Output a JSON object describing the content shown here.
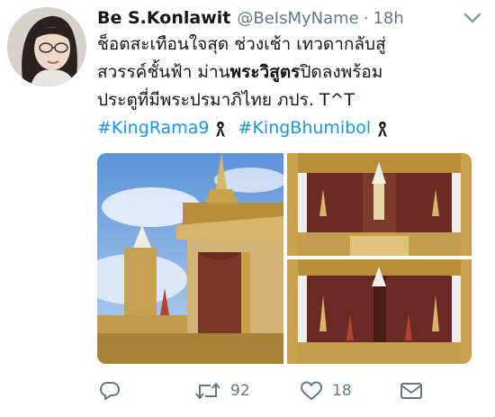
{
  "tweet": {
    "display_name": "Be S.Konlawit",
    "handle": "@BeIsMyName",
    "separator": "·",
    "time": "18h",
    "text": {
      "line1": "ช็อตสะเทือนใจสุด ช่วงเช้า เทวดากลับสู่",
      "line2_a": "สวรรค์ชั้นฟ้า ม่าน",
      "line2_bold": "พระวิสูตร",
      "line2_b": "ปิดลงพร้อม",
      "line3": "ประตูที่มีพระปรมาภิไทย ภปร. T^T"
    },
    "hashtags": [
      "#KingRama9",
      "#KingBhumibol"
    ]
  },
  "actions": {
    "reply_icon": "reply-icon",
    "retweet_icon": "retweet-icon",
    "retweet_count": "92",
    "like_icon": "heart-icon",
    "like_count": "18",
    "dm_icon": "envelope-icon"
  },
  "colors": {
    "link": "#1b95e0",
    "secondary": "#657786",
    "gold": "#c9a14a",
    "sky": "#8fb7e6"
  }
}
